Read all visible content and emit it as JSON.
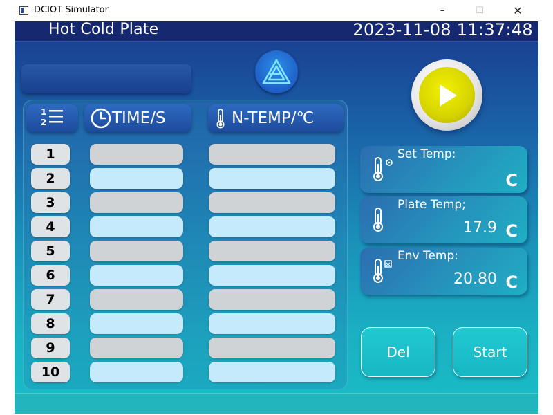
{
  "window": {
    "title": "DCIOT Simulator",
    "minimize_glyph": "–",
    "maximize_glyph": "☐",
    "close_glyph": "✕"
  },
  "header": {
    "title": "Hot Cold Plate",
    "datetime": "2023-11-08 11:37:48"
  },
  "table": {
    "columns": {
      "time": "TIME/S",
      "temp": "N-TEMP/℃"
    },
    "rows": [
      {
        "index": "1",
        "time": "",
        "temp": ""
      },
      {
        "index": "2",
        "time": "",
        "temp": ""
      },
      {
        "index": "3",
        "time": "",
        "temp": ""
      },
      {
        "index": "4",
        "time": "",
        "temp": ""
      },
      {
        "index": "5",
        "time": "",
        "temp": ""
      },
      {
        "index": "6",
        "time": "",
        "temp": ""
      },
      {
        "index": "7",
        "time": "",
        "temp": ""
      },
      {
        "index": "8",
        "time": "",
        "temp": ""
      },
      {
        "index": "9",
        "time": "",
        "temp": ""
      },
      {
        "index": "10",
        "time": "",
        "temp": ""
      }
    ]
  },
  "cards": {
    "set_temp": {
      "label": "Set Temp:",
      "value": "",
      "unit": "C"
    },
    "plate_temp": {
      "label": "Plate Temp;",
      "value": "17.9",
      "unit": "C"
    },
    "env_temp": {
      "label": "Env Temp:",
      "value": "20.80",
      "unit": "C"
    }
  },
  "buttons": {
    "del": "Del",
    "start": "Start"
  },
  "icons": {
    "window": "app-window-icon",
    "logo": "triangle-logo-icon",
    "play": "play-icon",
    "list": "numbered-list-icon",
    "clock": "clock-icon",
    "thermometer": "thermometer-icon"
  },
  "colors": {
    "header": "#15276f",
    "accent_teal": "#19bcc6",
    "play_yellow": "#e6e300"
  }
}
